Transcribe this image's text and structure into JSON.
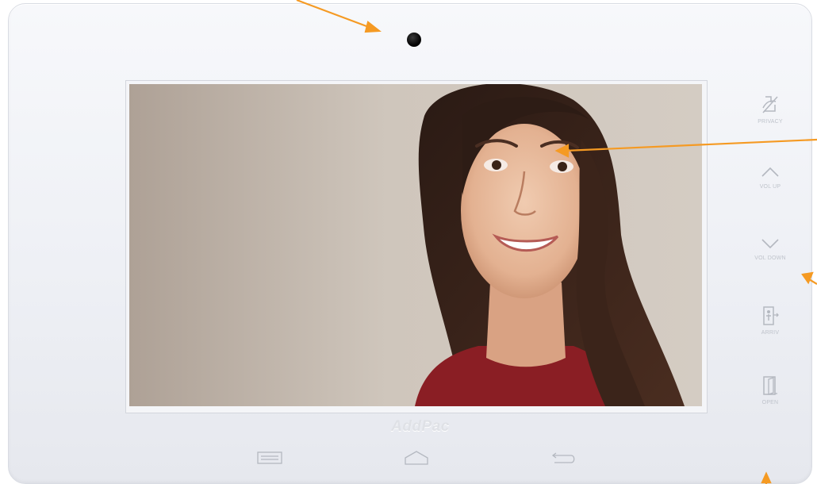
{
  "device": {
    "brand_logo": "AddPac"
  },
  "side_buttons": [
    {
      "label": "PRIVACY",
      "icon": "privacy-icon"
    },
    {
      "label": "VOL UP",
      "icon": "chevron-up-icon"
    },
    {
      "label": "VOL DOWN",
      "icon": "chevron-down-icon"
    },
    {
      "label": "ARRIV",
      "icon": "door-person-icon"
    },
    {
      "label": "OPEN",
      "icon": "door-open-icon"
    }
  ],
  "nav_bar": [
    {
      "icon": "menu-icon"
    },
    {
      "icon": "home-icon"
    },
    {
      "icon": "back-icon"
    }
  ],
  "colors": {
    "annotation_arrow": "#f59a23",
    "bezel": "#eef0f5",
    "icon_gray": "#b4b8c0",
    "label_gray": "#bfc3cb"
  }
}
